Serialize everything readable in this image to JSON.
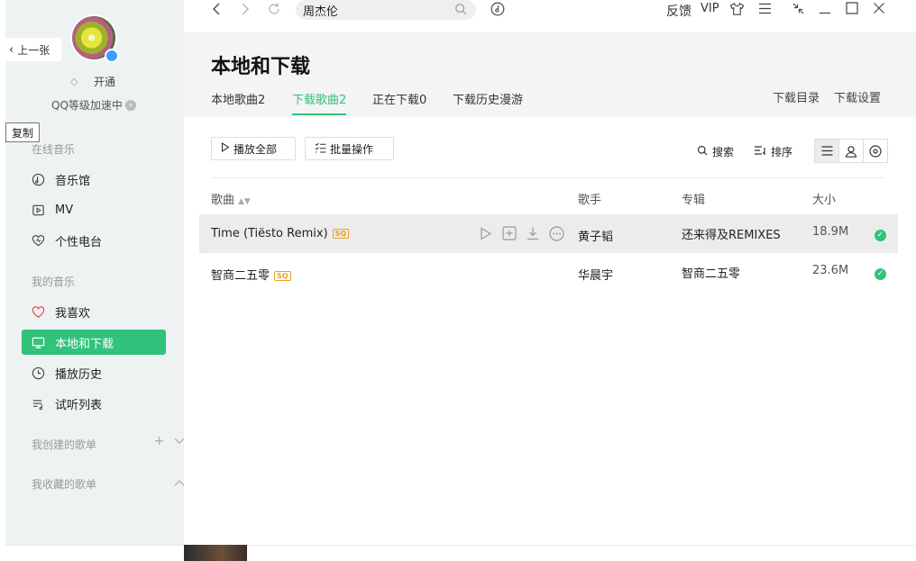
{
  "sidebar": {
    "back_label": "上一张",
    "open_label": "开通",
    "qq_level_label": "QQ等级加速中",
    "copy_tooltip": "复制",
    "online_music_title": "在线音乐",
    "my_music_title": "我的音乐",
    "online_items": [
      {
        "label": "音乐馆",
        "icon": "music-hall-icon"
      },
      {
        "label": "MV",
        "icon": "mv-icon"
      },
      {
        "label": "个性电台",
        "icon": "radio-heart-icon"
      }
    ],
    "my_items": [
      {
        "label": "我喜欢",
        "icon": "heart-icon"
      },
      {
        "label": "本地和下载",
        "icon": "monitor-icon",
        "active": true
      },
      {
        "label": "播放历史",
        "icon": "clock-icon"
      },
      {
        "label": "试听列表",
        "icon": "playlist-icon"
      }
    ],
    "created_playlists_title": "我创建的歌单",
    "collected_playlists_title": "我收藏的歌单"
  },
  "topbar": {
    "search_value": "周杰伦",
    "feedback_label": "反馈",
    "vip_label": "VIP"
  },
  "header": {
    "title": "本地和下载",
    "tabs": [
      {
        "label": "本地歌曲2",
        "active": false
      },
      {
        "label": "下载歌曲2",
        "active": true
      },
      {
        "label": "正在下载0",
        "active": false
      },
      {
        "label": "下载历史漫游",
        "active": false
      }
    ],
    "download_dir_label": "下载目录",
    "download_settings_label": "下载设置"
  },
  "toolbar": {
    "play_all_label": "播放全部",
    "batch_label": "批量操作",
    "search_label": "搜索",
    "sort_label": "排序"
  },
  "table": {
    "columns": {
      "song": "歌曲",
      "artist": "歌手",
      "album": "专辑",
      "size": "大小"
    },
    "quality_badge": "SQ",
    "rows": [
      {
        "song": "Time (Tiësto Remix)",
        "artist": "黄子韬",
        "album": "还来得及REMIXES",
        "size": "18.9M"
      },
      {
        "song": "智商二五零",
        "artist": "华晨宇",
        "album": "智商二五零",
        "size": "23.6M"
      }
    ]
  },
  "colors": {
    "accent": "#31c27c",
    "badge": "#f0a020"
  }
}
